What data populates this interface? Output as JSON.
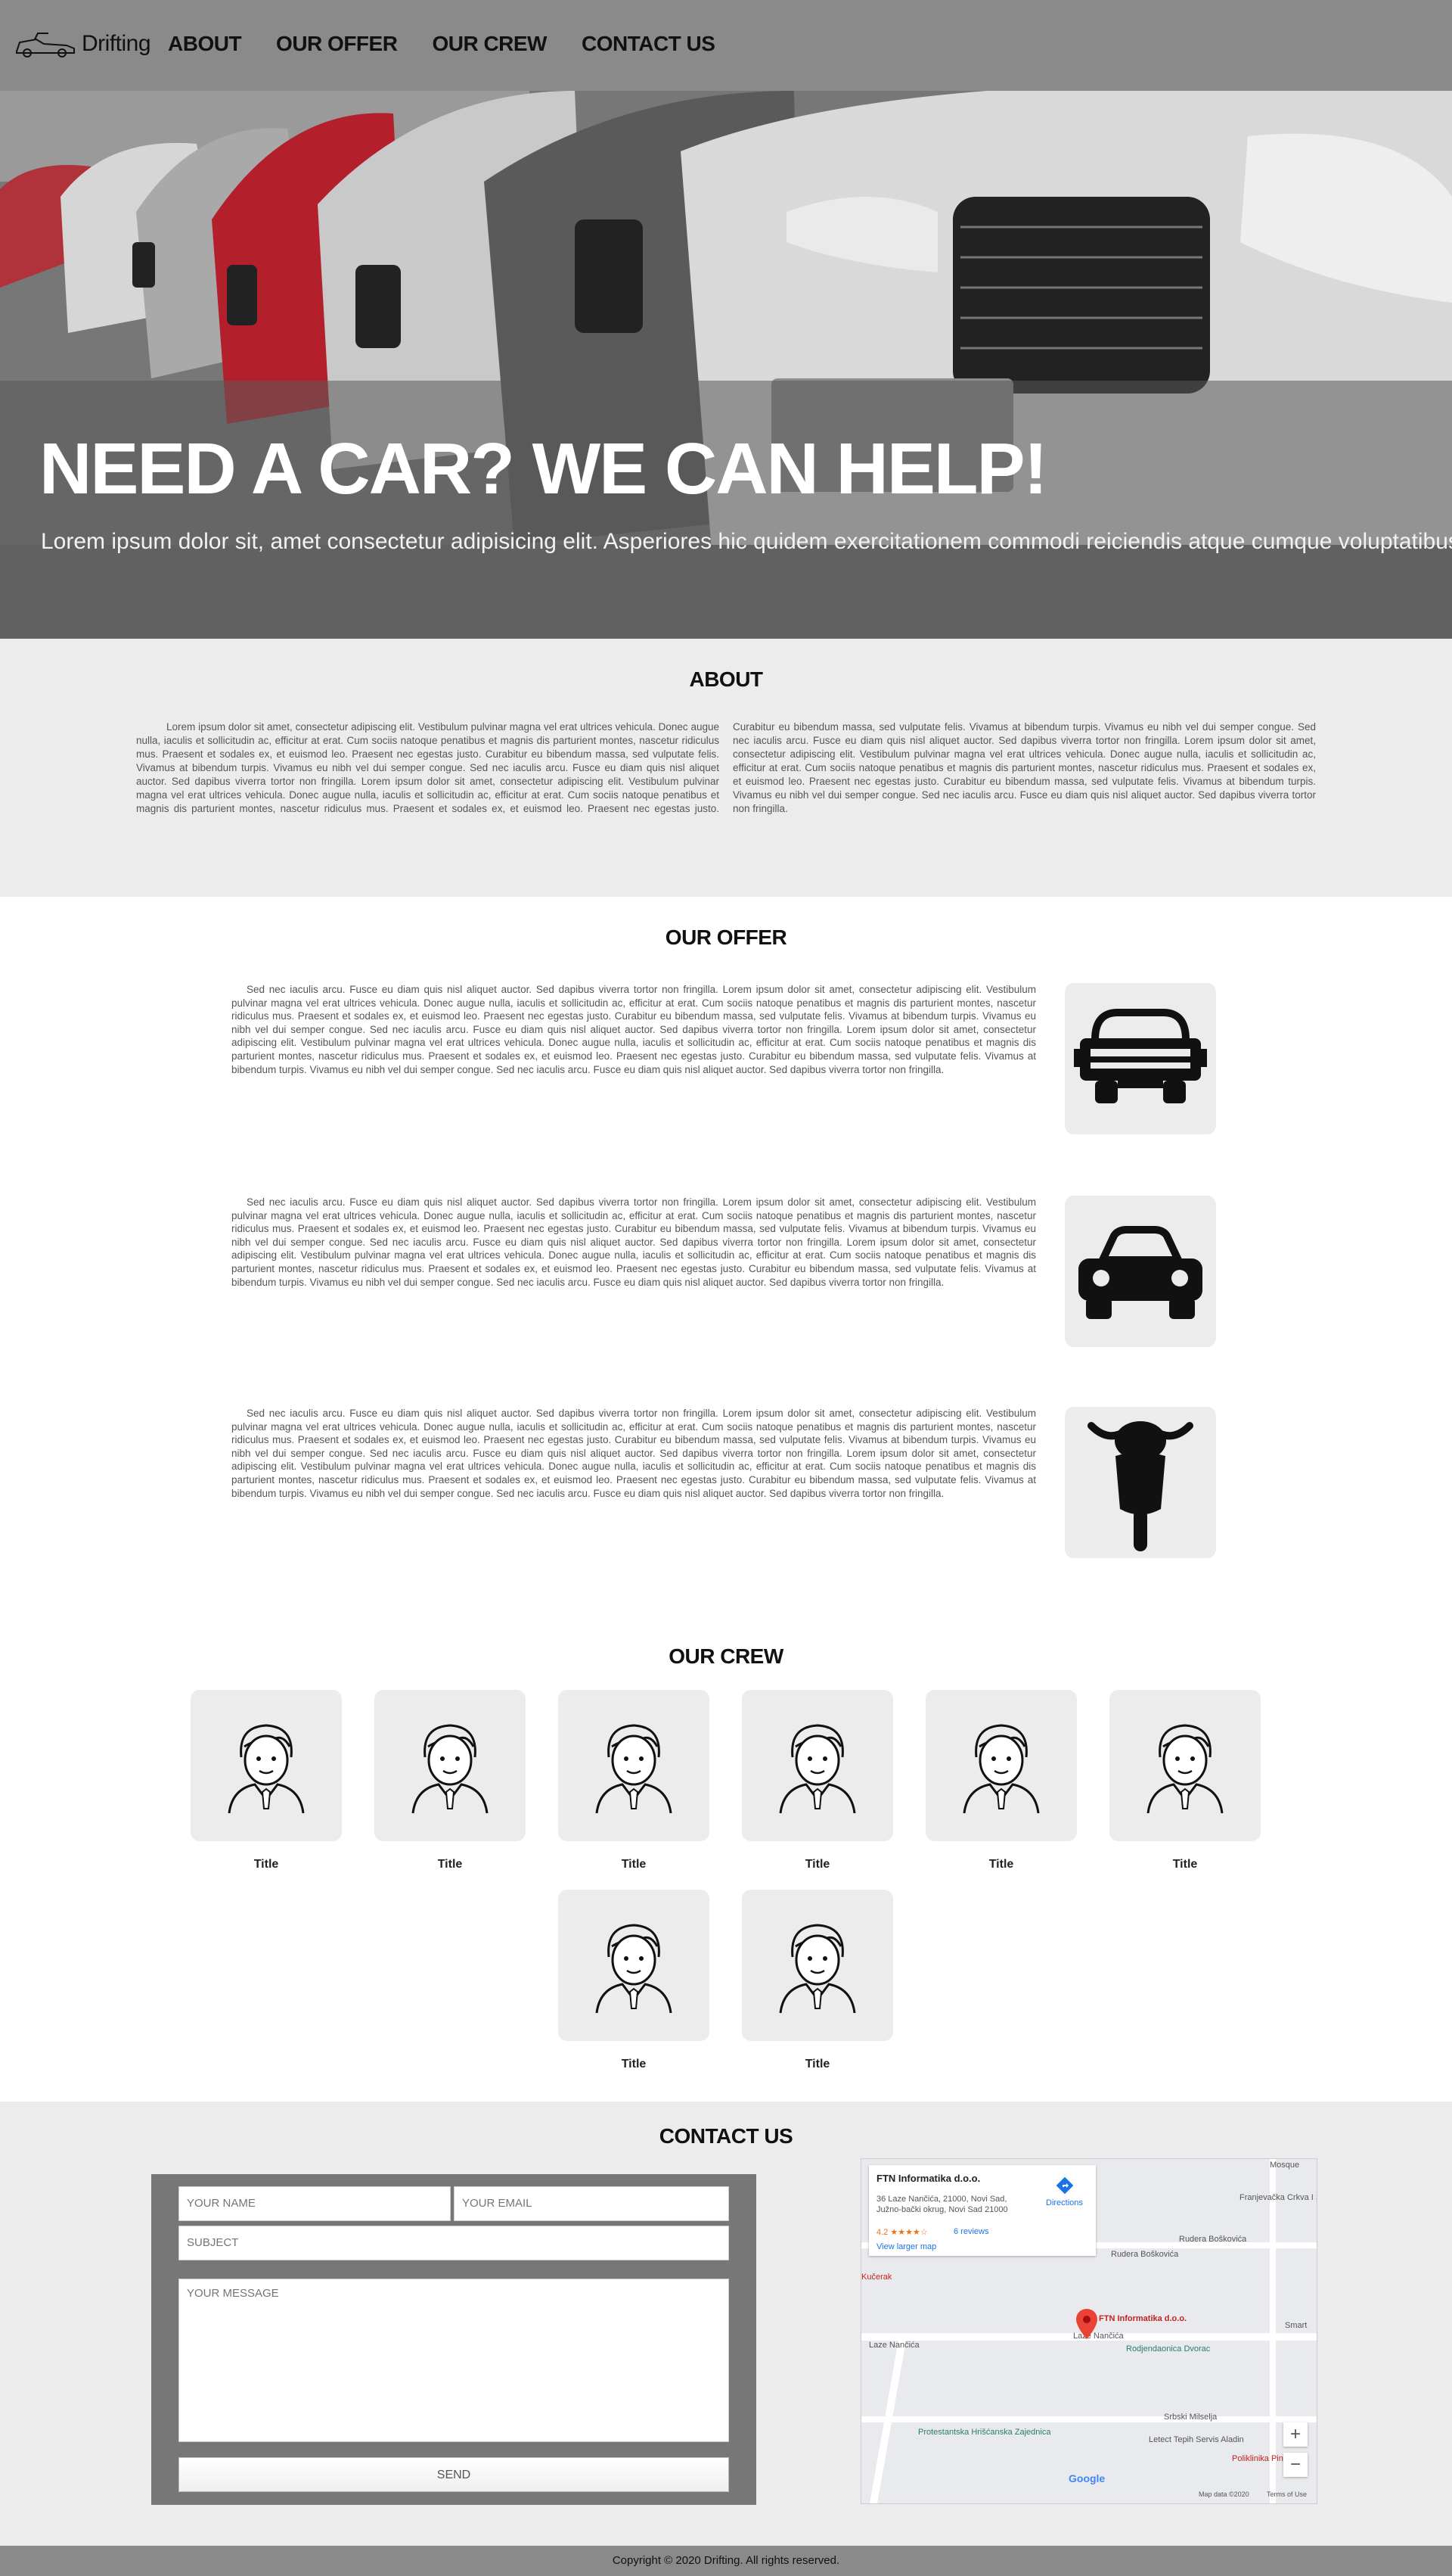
{
  "nav": {
    "brand": "Drifting",
    "links": [
      "ABOUT",
      "OUR OFFER",
      "OUR CREW",
      "CONTACT US"
    ]
  },
  "hero": {
    "title": "NEED A CAR? WE CAN HELP!",
    "text": "Lorem ipsum dolor sit, amet consectetur adipisicing elit. Asperiores hic quidem exercitationem commodi reiciendis atque cumque voluptatibus omnis! Consequuntur eius sit atque illum quae eligendi, voluptates mollitia doloremque corporis quidem."
  },
  "about": {
    "title": "ABOUT",
    "text": "Lorem ipsum dolor sit amet, consectetur adipiscing elit. Vestibulum pulvinar magna vel erat ultrices vehicula. Donec augue nulla, iaculis et sollicitudin ac, efficitur at erat. Cum sociis natoque penatibus et magnis dis parturient montes, nascetur ridiculus mus. Praesent et sodales ex, et euismod leo. Praesent nec egestas justo. Curabitur eu bibendum massa, sed vulputate felis. Vivamus at bibendum turpis. Vivamus eu nibh vel dui semper congue. Sed nec iaculis arcu. Fusce eu diam quis nisl aliquet auctor. Sed dapibus viverra tortor non fringilla. Lorem ipsum dolor sit amet, consectetur adipiscing elit. Vestibulum pulvinar magna vel erat ultrices vehicula. Donec augue nulla, iaculis et sollicitudin ac, efficitur at erat. Cum sociis natoque penatibus et magnis dis parturient montes, nascetur ridiculus mus. Praesent et sodales ex, et euismod leo. Praesent nec egestas justo. Curabitur eu bibendum massa, sed vulputate felis. Vivamus at bibendum turpis. Vivamus eu nibh vel dui semper congue. Sed nec iaculis arcu. Fusce eu diam quis nisl aliquet auctor. Sed dapibus viverra tortor non fringilla. Lorem ipsum dolor sit amet, consectetur adipiscing elit. Vestibulum pulvinar magna vel erat ultrices vehicula. Donec augue nulla, iaculis et sollicitudin ac, efficitur at erat. Cum sociis natoque penatibus et magnis dis parturient montes, nascetur ridiculus mus. Praesent et sodales ex, et euismod leo. Praesent nec egestas justo. Curabitur eu bibendum massa, sed vulputate felis. Vivamus at bibendum turpis. Vivamus eu nibh vel dui semper congue. Sed nec iaculis arcu. Fusce eu diam quis nisl aliquet auctor. Sed dapibus viverra tortor non fringilla."
  },
  "offer": {
    "title": "OUR OFFER",
    "items": [
      {
        "icon": "jeep-icon",
        "text": "Sed nec iaculis arcu. Fusce eu diam quis nisl aliquet auctor. Sed dapibus viverra tortor non fringilla. Lorem ipsum dolor sit amet, consectetur adipiscing elit. Vestibulum pulvinar magna vel erat ultrices vehicula. Donec augue nulla, iaculis et sollicitudin ac, efficitur at erat. Cum sociis natoque penatibus et magnis dis parturient montes, nascetur ridiculus mus. Praesent et sodales ex, et euismod leo. Praesent nec egestas justo. Curabitur eu bibendum massa, sed vulputate felis. Vivamus at bibendum turpis. Vivamus eu nibh vel dui semper congue. Sed nec iaculis arcu. Fusce eu diam quis nisl aliquet auctor. Sed dapibus viverra tortor non fringilla. Lorem ipsum dolor sit amet, consectetur adipiscing elit. Vestibulum pulvinar magna vel erat ultrices vehicula. Donec augue nulla, iaculis et sollicitudin ac, efficitur at erat. Cum sociis natoque penatibus et magnis dis parturient montes, nascetur ridiculus mus. Praesent et sodales ex, et euismod leo. Praesent nec egestas justo. Curabitur eu bibendum massa, sed vulputate felis. Vivamus at bibendum turpis. Vivamus eu nibh vel dui semper congue. Sed nec iaculis arcu. Fusce eu diam quis nisl aliquet auctor. Sed dapibus viverra tortor non fringilla."
      },
      {
        "icon": "car-icon",
        "text": "Sed nec iaculis arcu. Fusce eu diam quis nisl aliquet auctor. Sed dapibus viverra tortor non fringilla. Lorem ipsum dolor sit amet, consectetur adipiscing elit. Vestibulum pulvinar magna vel erat ultrices vehicula. Donec augue nulla, iaculis et sollicitudin ac, efficitur at erat. Cum sociis natoque penatibus et magnis dis parturient montes, nascetur ridiculus mus. Praesent et sodales ex, et euismod leo. Praesent nec egestas justo. Curabitur eu bibendum massa, sed vulputate felis. Vivamus at bibendum turpis. Vivamus eu nibh vel dui semper congue. Sed nec iaculis arcu. Fusce eu diam quis nisl aliquet auctor. Sed dapibus viverra tortor non fringilla. Lorem ipsum dolor sit amet, consectetur adipiscing elit. Vestibulum pulvinar magna vel erat ultrices vehicula. Donec augue nulla, iaculis et sollicitudin ac, efficitur at erat. Cum sociis natoque penatibus et magnis dis parturient montes, nascetur ridiculus mus. Praesent et sodales ex, et euismod leo. Praesent nec egestas justo. Curabitur eu bibendum massa, sed vulputate felis. Vivamus at bibendum turpis. Vivamus eu nibh vel dui semper congue. Sed nec iaculis arcu. Fusce eu diam quis nisl aliquet auctor. Sed dapibus viverra tortor non fringilla."
      },
      {
        "icon": "motorcycle-icon",
        "text": "Sed nec iaculis arcu. Fusce eu diam quis nisl aliquet auctor. Sed dapibus viverra tortor non fringilla. Lorem ipsum dolor sit amet, consectetur adipiscing elit. Vestibulum pulvinar magna vel erat ultrices vehicula. Donec augue nulla, iaculis et sollicitudin ac, efficitur at erat. Cum sociis natoque penatibus et magnis dis parturient montes, nascetur ridiculus mus. Praesent et sodales ex, et euismod leo. Praesent nec egestas justo. Curabitur eu bibendum massa, sed vulputate felis. Vivamus at bibendum turpis. Vivamus eu nibh vel dui semper congue. Sed nec iaculis arcu. Fusce eu diam quis nisl aliquet auctor. Sed dapibus viverra tortor non fringilla. Lorem ipsum dolor sit amet, consectetur adipiscing elit. Vestibulum pulvinar magna vel erat ultrices vehicula. Donec augue nulla, iaculis et sollicitudin ac, efficitur at erat. Cum sociis natoque penatibus et magnis dis parturient montes, nascetur ridiculus mus. Praesent et sodales ex, et euismod leo. Praesent nec egestas justo. Curabitur eu bibendum massa, sed vulputate felis. Vivamus at bibendum turpis. Vivamus eu nibh vel dui semper congue. Sed nec iaculis arcu. Fusce eu diam quis nisl aliquet auctor. Sed dapibus viverra tortor non fringilla."
      }
    ]
  },
  "crew": {
    "title": "OUR CREW",
    "members": [
      {
        "name": "Title"
      },
      {
        "name": "Title"
      },
      {
        "name": "Title"
      },
      {
        "name": "Title"
      },
      {
        "name": "Title"
      },
      {
        "name": "Title"
      },
      {
        "name": "Title"
      },
      {
        "name": "Title"
      }
    ]
  },
  "contact": {
    "title": "CONTACT US",
    "name_placeholder": "YOUR NAME",
    "email_placeholder": "YOUR EMAIL",
    "subject_placeholder": "SUBJECT",
    "message_placeholder": "YOUR MESSAGE",
    "send_label": "SEND"
  },
  "map": {
    "place_name": "FTN Informatika d.o.o.",
    "address": "36 Laze Nančića, 21000, Novi Sad, Južno-bački okrug, Novi Sad 21000",
    "rating": "4.2 ★★★★☆",
    "reviews": "6 reviews",
    "directions": "Directions",
    "larger_map": "View larger map",
    "pin_label": "FTN Informatika d.o.o.",
    "labels": [
      "Rudera Boškovića",
      "Rudera Boškovića",
      "Laze Nančića",
      "Laze Nančića",
      "Rodjendaonica Dvorac",
      "Protestantska Hrišćanska Zajednica",
      "Letect Tepih Servis Aladin",
      "Franjevačka Crkva I Samostan Svetog...",
      "Mosque",
      "Kučerak",
      "Smart",
      "Poliklinika Pinus",
      "Srbski Milselja"
    ],
    "attribution": "Map data ©2020",
    "terms": "Terms of Use",
    "zoom_in": "+",
    "zoom_out": "−",
    "google": "Google"
  },
  "footer": {
    "text": "Copyright © 2020 Drifting. All rights reserved."
  }
}
